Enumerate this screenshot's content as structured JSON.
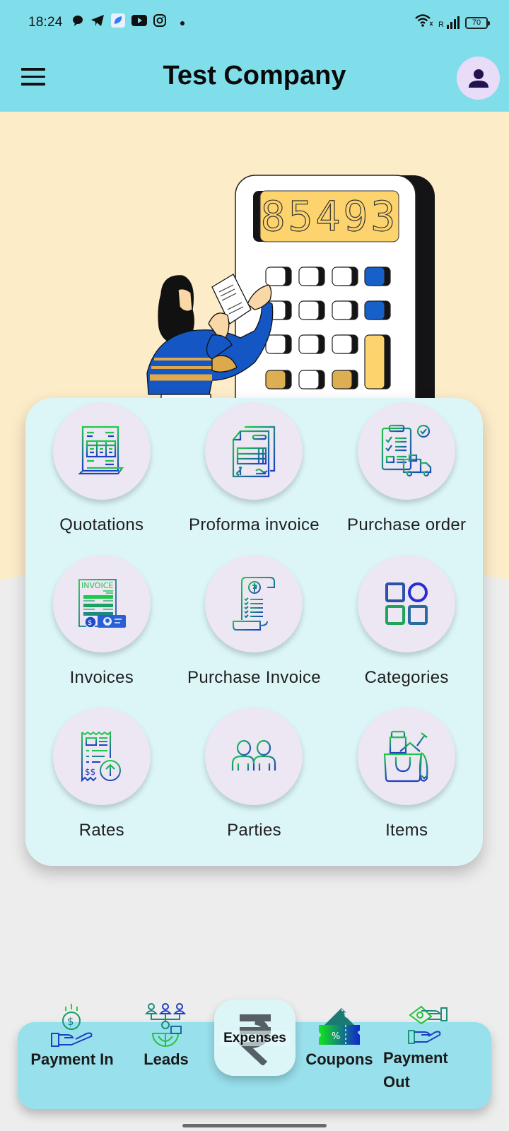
{
  "status_bar": {
    "time": "18:24",
    "notification_icons": [
      "chat-bubble-icon",
      "telegram-icon",
      "blue-app-icon",
      "youtube-icon",
      "instagram-icon",
      "more-dot-icon"
    ],
    "signal_label": "R",
    "battery": "70"
  },
  "app_bar": {
    "title": "Test Company",
    "menu_icon": "hamburger-menu-icon",
    "profile_icon": "person-icon"
  },
  "hero": {
    "calculator_display": "85493"
  },
  "grid": {
    "items": [
      {
        "label": "Quotations",
        "icon": "quotation-document-icon"
      },
      {
        "label": "Proforma invoice",
        "icon": "proforma-invoice-icon"
      },
      {
        "label": "Purchase order",
        "icon": "purchase-order-clipboard-icon"
      },
      {
        "label": "Invoices",
        "icon": "invoice-icon"
      },
      {
        "label": "Purchase Invoice",
        "icon": "receipt-scroll-icon"
      },
      {
        "label": "Categories",
        "icon": "categories-grid-icon"
      },
      {
        "label": "Rates",
        "icon": "rates-receipt-icon"
      },
      {
        "label": "Parties",
        "icon": "people-icon"
      },
      {
        "label": "Items",
        "icon": "shopping-bag-icon"
      }
    ]
  },
  "bottom_nav": {
    "items": [
      {
        "label": "Payment In",
        "icon": "payment-in-icon"
      },
      {
        "label": "Leads",
        "icon": "leads-network-icon"
      },
      {
        "label": "Coupons",
        "icon": "coupon-ticket-icon"
      },
      {
        "label": "Payment",
        "label2": "Out",
        "icon": "payment-out-icon"
      }
    ],
    "center": {
      "label": "Expenses",
      "icon": "rupee-icon"
    }
  },
  "colors": {
    "app_bar": "#80deea",
    "hero_bg": "#fdecc8",
    "card_bg": "#dcf6f8",
    "tile_circle": "#ede6f3",
    "nav_bg": "#98e0ec",
    "icon_gradient_start": "#1ec94a",
    "icon_gradient_end": "#1d3fc4"
  }
}
